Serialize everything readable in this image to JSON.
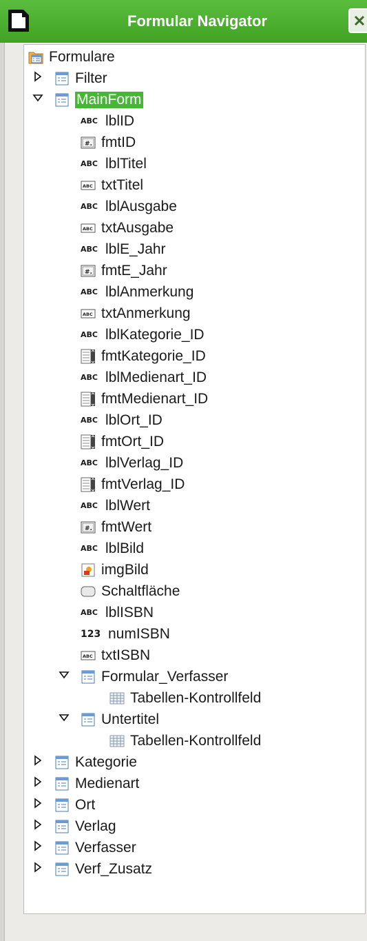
{
  "window": {
    "title": "Formular Navigator"
  },
  "tree": {
    "root": "Formulare",
    "filter": "Filter",
    "mainform": "MainForm",
    "mainform_items": [
      {
        "label": "lblID",
        "icon": "label-abc-icon"
      },
      {
        "label": "fmtID",
        "icon": "formatted-field-icon"
      },
      {
        "label": "lblTitel",
        "icon": "label-abc-icon"
      },
      {
        "label": "txtTitel",
        "icon": "text-box-icon"
      },
      {
        "label": "lblAusgabe",
        "icon": "label-abc-icon"
      },
      {
        "label": "txtAusgabe",
        "icon": "text-box-icon"
      },
      {
        "label": "lblE_Jahr",
        "icon": "label-abc-icon"
      },
      {
        "label": "fmtE_Jahr",
        "icon": "formatted-field-icon"
      },
      {
        "label": "lblAnmerkung",
        "icon": "label-abc-icon"
      },
      {
        "label": "txtAnmerkung",
        "icon": "text-box-icon"
      },
      {
        "label": "lblKategorie_ID",
        "icon": "label-abc-icon"
      },
      {
        "label": "fmtKategorie_ID",
        "icon": "list-box-icon"
      },
      {
        "label": "lblMedienart_ID",
        "icon": "label-abc-icon"
      },
      {
        "label": "fmtMedienart_ID",
        "icon": "list-box-icon"
      },
      {
        "label": "lblOrt_ID",
        "icon": "label-abc-icon"
      },
      {
        "label": "fmtOrt_ID",
        "icon": "list-box-icon"
      },
      {
        "label": "lblVerlag_ID",
        "icon": "label-abc-icon"
      },
      {
        "label": "fmtVerlag_ID",
        "icon": "list-box-icon"
      },
      {
        "label": "lblWert",
        "icon": "label-abc-icon"
      },
      {
        "label": "fmtWert",
        "icon": "formatted-field-icon"
      },
      {
        "label": "lblBild",
        "icon": "label-abc-icon"
      },
      {
        "label": "imgBild",
        "icon": "image-control-icon"
      },
      {
        "label": "Schaltfläche",
        "icon": "push-button-icon"
      },
      {
        "label": "lblISBN",
        "icon": "label-abc-icon"
      },
      {
        "label": "numISBN",
        "icon": "numeric-field-icon"
      },
      {
        "label": "txtISBN",
        "icon": "text-box-icon"
      }
    ],
    "subforms": [
      {
        "label": "Formular_Verfasser",
        "child": "Tabellen-Kontrollfeld"
      },
      {
        "label": "Untertitel",
        "child": "Tabellen-Kontrollfeld"
      }
    ],
    "other_forms": [
      "Kategorie",
      "Medienart",
      "Ort",
      "Verlag",
      "Verfasser",
      "Verf_Zusatz"
    ],
    "icon_text": {
      "abc": "ABC",
      "num": "123"
    }
  }
}
